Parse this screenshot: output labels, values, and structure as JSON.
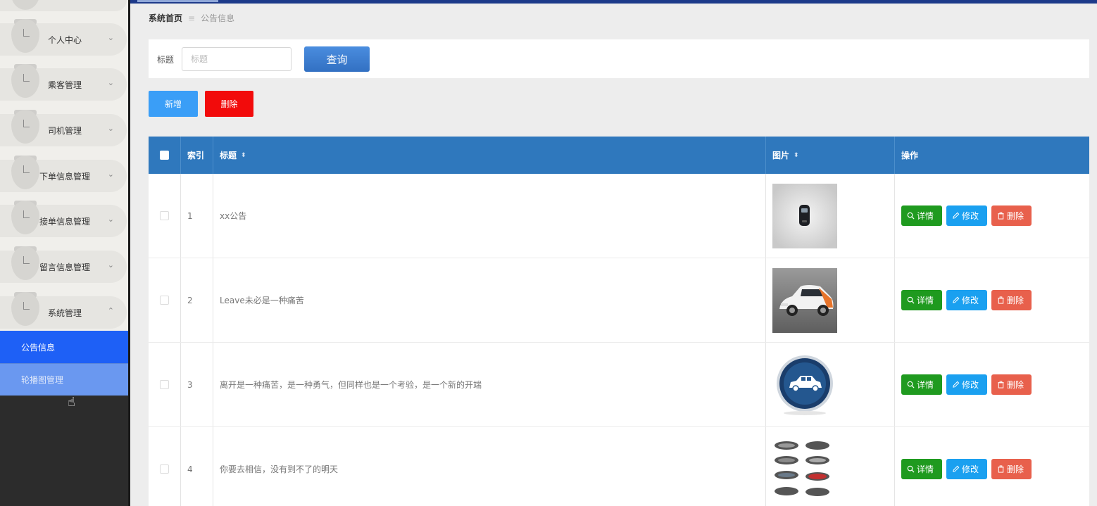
{
  "sidebar": {
    "items": [
      {
        "label": "个人中心",
        "expanded": false
      },
      {
        "label": "乘客管理",
        "expanded": false
      },
      {
        "label": "司机管理",
        "expanded": false
      },
      {
        "label": "下单信息管理",
        "expanded": false
      },
      {
        "label": "接单信息管理",
        "expanded": false
      },
      {
        "label": "留言信息管理",
        "expanded": false
      },
      {
        "label": "系统管理",
        "expanded": true
      }
    ],
    "subitems": [
      {
        "label": "公告信息",
        "active": true
      },
      {
        "label": "轮播图管理",
        "active": false
      }
    ],
    "chevron_down": "⌄",
    "chevron_up": "⌃"
  },
  "breadcrumb": {
    "home": "系统首页",
    "separator": "≡",
    "current": "公告信息"
  },
  "search": {
    "label": "标题",
    "placeholder": "标题",
    "button": "查询"
  },
  "actions": {
    "add": "新增",
    "delete": "删除"
  },
  "table": {
    "headers": {
      "index": "索引",
      "title": "标题",
      "image": "图片",
      "ops": "操作"
    },
    "sort_icon": "⬍",
    "row_actions": {
      "detail": "详情",
      "edit": "修改",
      "remove": "删除"
    },
    "rows": [
      {
        "index": "1",
        "title": "xx公告",
        "image": "phone-car-key"
      },
      {
        "index": "2",
        "title": "Leave未必是一种痛苦",
        "image": "white-car"
      },
      {
        "index": "3",
        "title": "离开是一种痛苦，是一种勇气，但同样也是一个考验，是一个新的开端",
        "image": "car-circle-icon"
      },
      {
        "index": "4",
        "title": "你要去相信，没有到不了的明天",
        "image": "car-grid"
      }
    ]
  },
  "colors": {
    "header_blue": "#2f78bd",
    "active_blue": "#1e60f6",
    "detail_green": "#1f9a1f",
    "edit_blue": "#1aa0f0",
    "remove_red": "#e8604c",
    "delete_red": "#f20b0b",
    "add_blue": "#3a9ef7"
  }
}
